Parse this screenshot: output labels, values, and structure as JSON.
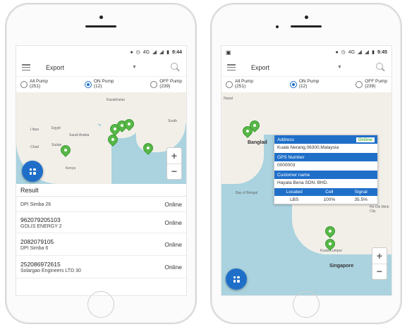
{
  "left_phone": {
    "status": {
      "signal_text": "4G",
      "time": "9:44"
    },
    "toolbar": {
      "title": "Export"
    },
    "filters": [
      {
        "label": "All Pump",
        "count": "(251)",
        "checked": false
      },
      {
        "label": "ON Pump",
        "count": "(12)",
        "checked": true
      },
      {
        "label": "OFF Pump",
        "count": "(239)",
        "checked": false
      }
    ],
    "map_labels": {
      "egypt": "Egypt",
      "libya": "Libya",
      "chad": "Chad",
      "sudan": "Sudan",
      "saudi": "Saudi Arabia",
      "kenya": "Kenya",
      "kazakhstan": "Kazakhstan",
      "south": "South"
    },
    "zoom": {
      "plus": "+",
      "minus": "−"
    },
    "result_title": "Result",
    "rows": [
      {
        "number": "",
        "name": "DPI Simba 26",
        "status": "Online"
      },
      {
        "number": "962079205103",
        "name": "GOLIS ENERGY 2",
        "status": "Online"
      },
      {
        "number": "2082079105",
        "name": "DPI Simba 6",
        "status": "Online"
      },
      {
        "number": "252086972615",
        "name": "Solargao Engineers LTD 30",
        "status": "Online"
      }
    ]
  },
  "right_phone": {
    "status": {
      "signal_text": "4G",
      "time": "9:45"
    },
    "toolbar": {
      "title": "Export"
    },
    "filters": [
      {
        "label": "All Pump",
        "count": "(251)",
        "checked": false
      },
      {
        "label": "ON Pump",
        "count": "(12)",
        "checked": true
      },
      {
        "label": "OFF Pump",
        "count": "(239)",
        "checked": false
      }
    ],
    "map_labels": {
      "nepal": "Nepal",
      "bangladesh": "Banglad",
      "bay": "Bay of Bengal",
      "kl": "Kuala Lumpur",
      "singapore": "Singapore",
      "hcm": "Ho Chi Minh City"
    },
    "zoom": {
      "plus": "+",
      "minus": "−"
    },
    "popup": {
      "address_label": "Address",
      "online": "Online",
      "address": "Kuala Nerang,06300,Malaysia",
      "gps_label": "GPS Number",
      "gps": "0000003",
      "customer_label": "Customer name",
      "customer": "Hayata Bena SDN. BHD.",
      "cols": [
        "Located",
        "Cell",
        "Signal"
      ],
      "vals": [
        "LBS",
        "100%",
        "35.5%"
      ]
    }
  },
  "colors": {
    "accent": "#1f6fc9",
    "pin": "#57b847",
    "water": "#aad3df",
    "land": "#f2efe9"
  }
}
